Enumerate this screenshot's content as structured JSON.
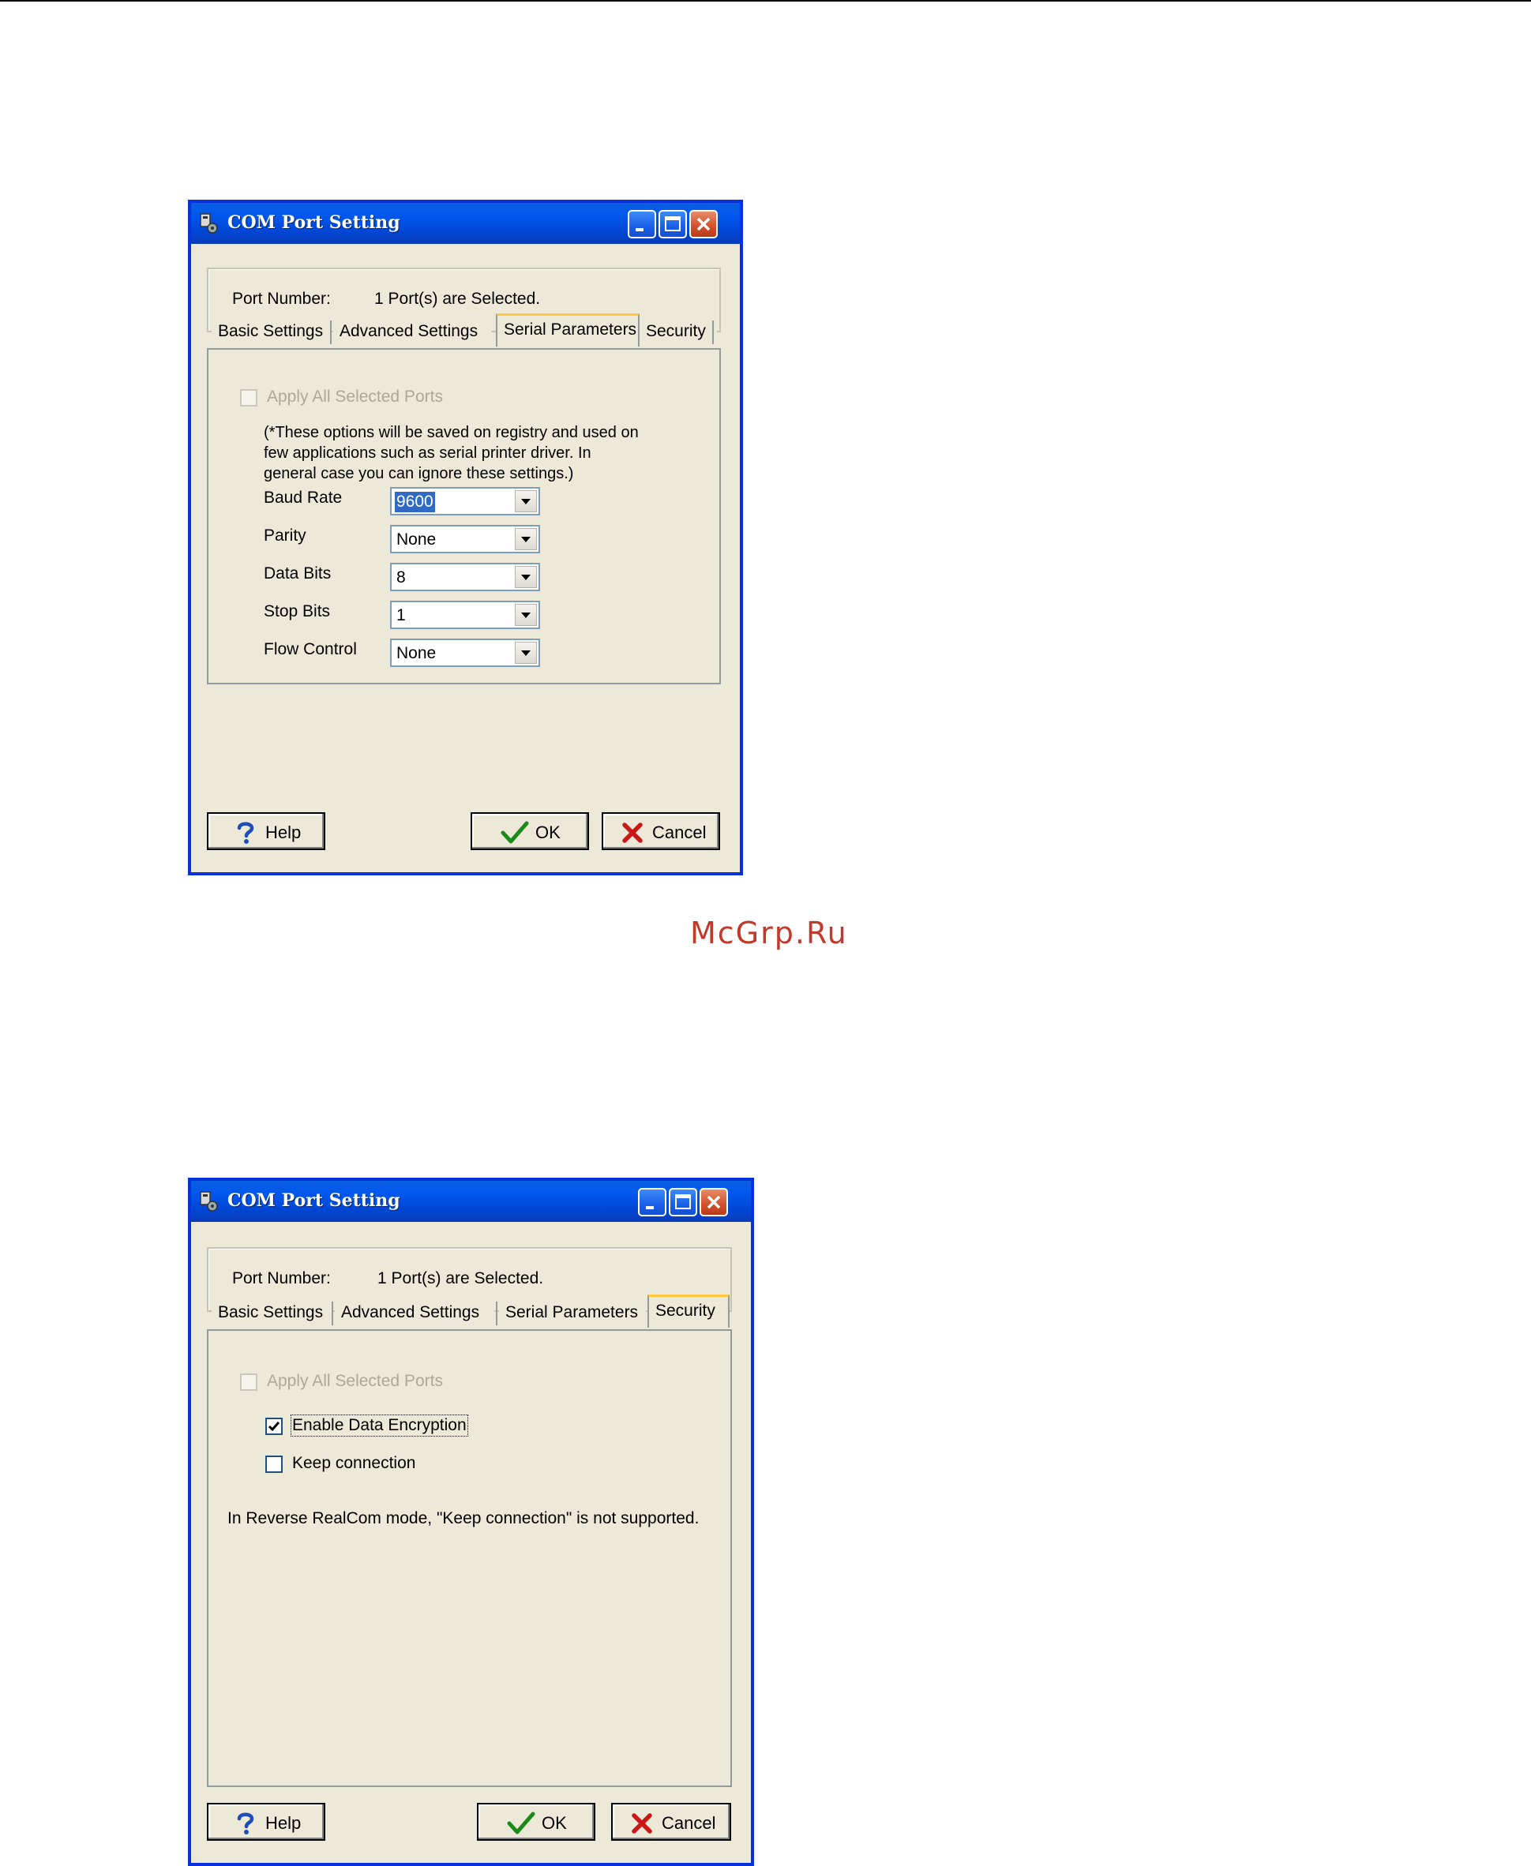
{
  "watermark": "McGrp.Ru",
  "dialogs": [
    {
      "title": "COM Port Setting",
      "port_label": "Port Number:",
      "port_value": "1 Port(s) are Selected.",
      "tabs": [
        "Basic Settings",
        "Advanced Settings",
        "Serial Parameters",
        "Security"
      ],
      "active_tab": "Serial Parameters",
      "apply_all_label": "Apply All Selected Ports",
      "note": "(*These options will be saved on registry and used on\nfew applications such as serial printer driver. In\ngeneral case you can ignore these settings.)",
      "fields": [
        {
          "label": "Baud Rate",
          "value": "9600"
        },
        {
          "label": "Parity",
          "value": "None"
        },
        {
          "label": "Data Bits",
          "value": "8"
        },
        {
          "label": "Stop Bits",
          "value": "1"
        },
        {
          "label": "Flow Control",
          "value": "None"
        }
      ],
      "buttons": {
        "help": "Help",
        "ok": "OK",
        "cancel": "Cancel"
      }
    },
    {
      "title": "COM Port Setting",
      "port_label": "Port Number:",
      "port_value": "1 Port(s) are Selected.",
      "tabs": [
        "Basic Settings",
        "Advanced Settings",
        "Serial Parameters",
        "Security"
      ],
      "active_tab": "Security",
      "apply_all_label": "Apply All Selected Ports",
      "enable_encryption_label": "Enable Data Encryption",
      "enable_encryption_checked": true,
      "keep_connection_label": "Keep connection",
      "keep_connection_checked": false,
      "info_text": "In Reverse RealCom mode, \"Keep connection\" is not supported.",
      "buttons": {
        "help": "Help",
        "ok": "OK",
        "cancel": "Cancel"
      }
    }
  ],
  "colors": {
    "title_bar": "#0058ee",
    "dialog_bg": "#ece9d8",
    "selection": "#316ac5",
    "active_tab_highlight": "#ffc83c",
    "watermark": "#c0392b"
  }
}
